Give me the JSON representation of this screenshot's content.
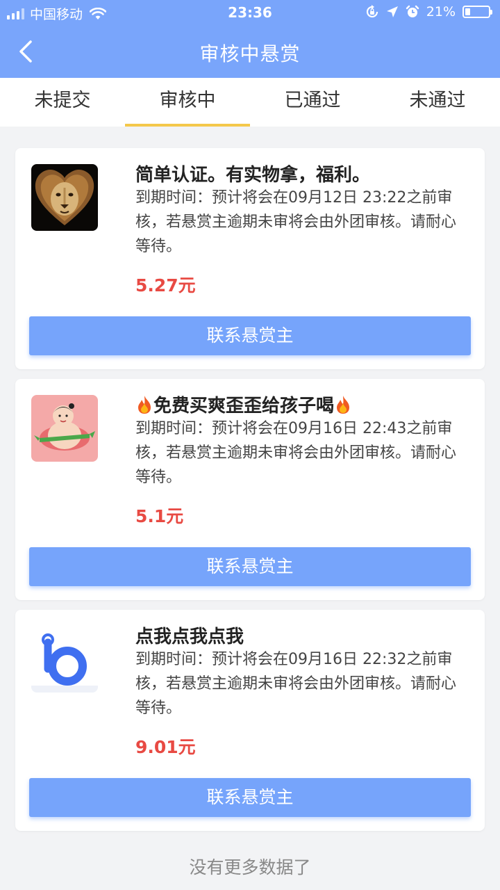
{
  "status_bar": {
    "carrier": "中国移动",
    "time": "23:36",
    "battery": "21%",
    "battery_level": 0.21
  },
  "nav": {
    "title": "审核中悬赏"
  },
  "tabs": [
    {
      "label": "未提交",
      "active": false
    },
    {
      "label": "审核中",
      "active": true
    },
    {
      "label": "已通过",
      "active": false
    },
    {
      "label": "未通过",
      "active": false
    }
  ],
  "cards": [
    {
      "avatar": "lion-heart-avatar",
      "title": "简单认证。有实物拿，福利。",
      "desc": "到期时间：预计将会在09月12日 23:22之前审核，若悬赏主逾期未审将会由外团审核。请耐心等待。",
      "price": "5.27元",
      "button": "联系悬赏主"
    },
    {
      "avatar": "cartoon-kid-avatar",
      "title": "免费买爽歪歪给孩子喝",
      "title_icons": "fire-icon",
      "desc": "到期时间：预计将会在09月16日 22:43之前审核，若悬赏主逾期未审将会由外团审核。请耐心等待。",
      "price": "5.1元",
      "button": "联系悬赏主"
    },
    {
      "avatar": "blue-b-logo-avatar",
      "title": "点我点我点我",
      "desc": "到期时间：预计将会在09月16日 22:32之前审核，若悬赏主逾期未审将会由外团审核。请耐心等待。",
      "price": "9.01元",
      "button": "联系悬赏主"
    }
  ],
  "footer": {
    "no_more": "没有更多数据了"
  },
  "colors": {
    "header": "#79a5fb",
    "button": "#76a4fb",
    "price": "#e84a43",
    "tab_indicator": "#f4c84b",
    "background": "#f2f3f5"
  }
}
